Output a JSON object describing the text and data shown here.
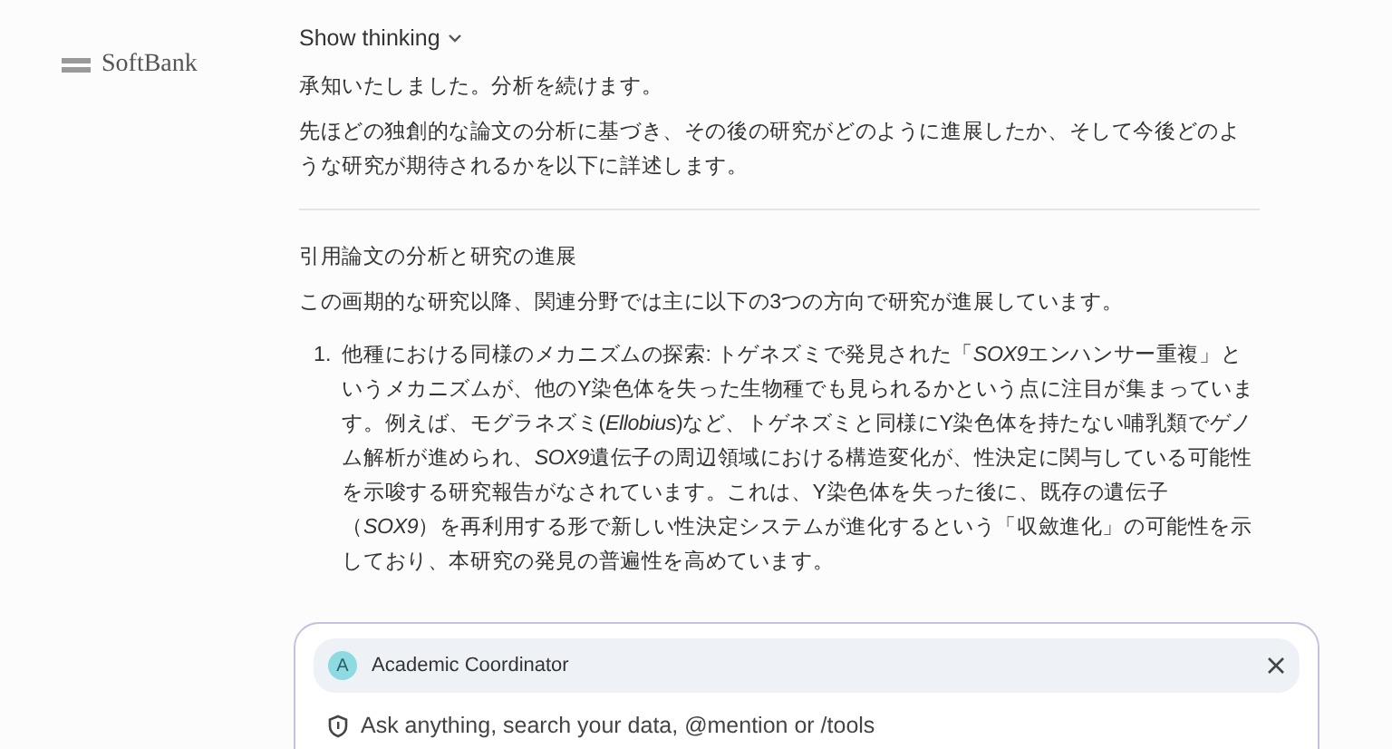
{
  "sidebar": {
    "logo": "SoftBank"
  },
  "thinking": {
    "label": "Show thinking",
    "expanded": false
  },
  "message": {
    "intro": [
      "承知いたしました。分析を続けます。",
      "先ほどの独創的な論文の分析に基づき、その後の研究がどのように進展したか、そして今後どのような研究が期待されるかを以下に詳述します。"
    ],
    "heading": "引用論文の分析と研究の進展",
    "lead": "この画期的な研究以降、関連分野では主に以下の3つの方向で研究が進展しています。",
    "items": [
      {
        "number": "1.",
        "segments": [
          {
            "text": "他種における同様のメカニズムの探索: トゲネズミで発見された「",
            "italic": false
          },
          {
            "text": "SOX9",
            "italic": true
          },
          {
            "text": "エンハンサー重複」というメカニズムが、他のY染色体を失った生物種でも見られるかという点に注目が集まっています。例えば、モグラネズミ(",
            "italic": false
          },
          {
            "text": "Ellobius",
            "italic": true
          },
          {
            "text": ")など、トゲネズミと同様にY染色体を持たない哺乳類でゲノム解析が進められ、",
            "italic": false
          },
          {
            "text": "SOX9",
            "italic": true
          },
          {
            "text": "遺伝子の周辺領域における構造変化が、性決定に関与している可能性を示唆する研究報告がなされています。これは、Y染色体を失った後に、既存の遺伝子（",
            "italic": false
          },
          {
            "text": "SOX9",
            "italic": true
          },
          {
            "text": "）を再利用する形で新しい性決定システムが進化するという「収斂進化」の可能性を示しており、本研究の発見の普遍性を高めています。",
            "italic": false
          }
        ]
      }
    ]
  },
  "composer": {
    "agent": {
      "initial": "A",
      "name": "Academic Coordinator"
    },
    "placeholder": "Ask anything, search your data, @mention or /tools"
  }
}
